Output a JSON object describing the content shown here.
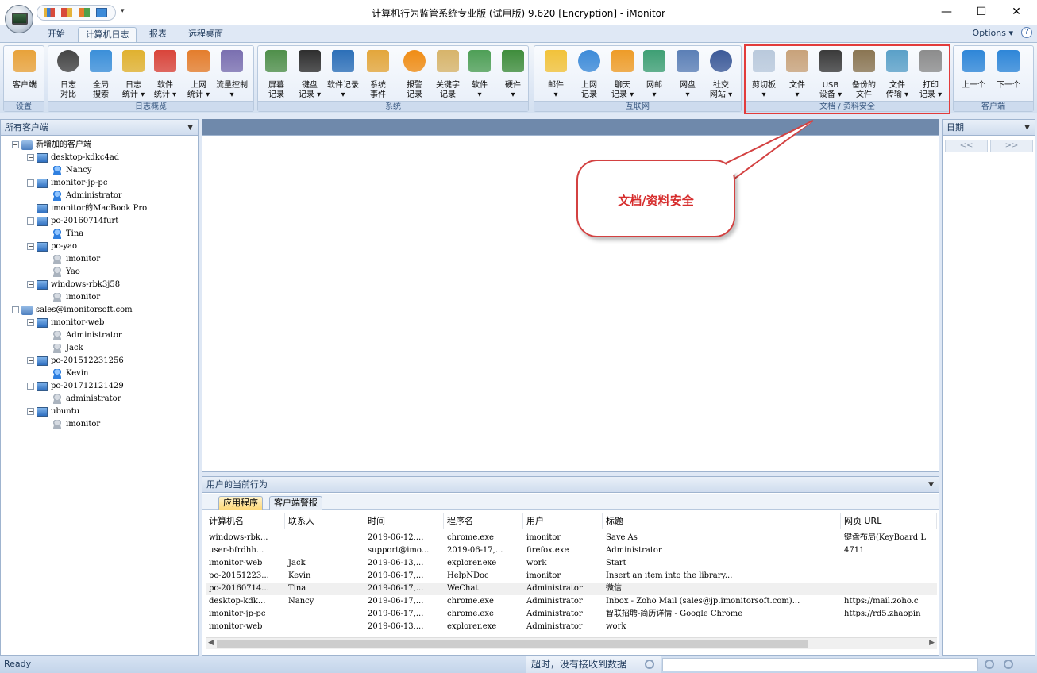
{
  "window": {
    "title": "计算机行为监管系统专业版 (试用版) 9.620 [Encryption] - iMonitor",
    "minimize": "—",
    "maximize": "☐",
    "close": "✕"
  },
  "quick_access": {
    "more": "▾"
  },
  "tabs": [
    {
      "label": "开始"
    },
    {
      "label": "计算机日志"
    },
    {
      "label": "报表"
    },
    {
      "label": "远程桌面"
    }
  ],
  "options": {
    "label": "Options ▾",
    "help": "?"
  },
  "ribbon": {
    "groups": [
      {
        "label": "设置",
        "buttons": [
          {
            "label": "客户端",
            "color": "#e8a23a"
          }
        ]
      },
      {
        "label": "日志概览",
        "buttons": [
          {
            "label": "日志\n对比",
            "color": "#444444"
          },
          {
            "label": "全局\n搜索",
            "color": "#3b8fd9"
          },
          {
            "label": "日志\n统计 ▾",
            "color": "#e0b12f"
          },
          {
            "label": "软件\n统计 ▾",
            "color": "#d9443a"
          },
          {
            "label": "上网\n统计 ▾",
            "color": "#e47d2c"
          },
          {
            "label": "流量控制\n▾",
            "color": "#7a6fb0"
          }
        ]
      },
      {
        "label": "系统",
        "buttons": [
          {
            "label": "屏幕\n记录",
            "color": "#4f8f4a"
          },
          {
            "label": "键盘\n记录 ▾",
            "color": "#2e2e2e"
          },
          {
            "label": "软件记录\n▾",
            "color": "#2c6fb8"
          },
          {
            "label": "系统\n事件",
            "color": "#e3a63b"
          },
          {
            "label": "报警\n记录",
            "color": "#f08c14"
          },
          {
            "label": "关键字\n记录",
            "color": "#d7b46a"
          },
          {
            "label": "软件\n▾",
            "color": "#4e9f56"
          },
          {
            "label": "硬件\n▾",
            "color": "#3f8d3c"
          }
        ]
      },
      {
        "label": "互联网",
        "buttons": [
          {
            "label": "邮件\n▾",
            "color": "#f2c23a"
          },
          {
            "label": "上网\n记录",
            "color": "#3c8ad8"
          },
          {
            "label": "聊天\n记录 ▾",
            "color": "#ee9c28"
          },
          {
            "label": "网邮\n▾",
            "color": "#3e9f74"
          },
          {
            "label": "网盘\n▾",
            "color": "#5b7fb6"
          },
          {
            "label": "社交\n网站 ▾",
            "color": "#3b5998"
          }
        ]
      },
      {
        "label": "文档 / 资料安全",
        "buttons": [
          {
            "label": "剪切板\n▾",
            "color": "#b9c9dc"
          },
          {
            "label": "文件\n▾",
            "color": "#c8a27a"
          },
          {
            "label": "USB\n设备 ▾",
            "color": "#3a3a3a"
          },
          {
            "label": "备份的\n文件",
            "color": "#8a7552"
          },
          {
            "label": "文件\n传输 ▾",
            "color": "#5aa0c8"
          },
          {
            "label": "打印\n记录 ▾",
            "color": "#8c8c8c"
          }
        ]
      },
      {
        "label": "客户端",
        "buttons": [
          {
            "label": "上一个",
            "color": "#2e86d8"
          },
          {
            "label": "下一个",
            "color": "#2e86d8"
          }
        ]
      }
    ]
  },
  "left_panel": {
    "title": "所有客户端",
    "drop": "▼",
    "tree": [
      {
        "label": "新增加的客户端",
        "kind": "group",
        "level": 0,
        "exp": "−"
      },
      {
        "label": "desktop-kdkc4ad",
        "kind": "pc",
        "level": 1,
        "exp": "−"
      },
      {
        "label": "Nancy",
        "kind": "user",
        "level": 2
      },
      {
        "label": "imonitor-jp-pc",
        "kind": "pc",
        "level": 1,
        "exp": "−"
      },
      {
        "label": "Administrator",
        "kind": "user",
        "level": 2
      },
      {
        "label": "imonitor的MacBook Pro",
        "kind": "pc",
        "level": 1
      },
      {
        "label": "pc-20160714furt",
        "kind": "pc",
        "level": 1,
        "exp": "−"
      },
      {
        "label": "Tina",
        "kind": "user",
        "level": 2
      },
      {
        "label": "pc-yao",
        "kind": "pc",
        "level": 1,
        "exp": "−"
      },
      {
        "label": "imonitor",
        "kind": "user-off",
        "level": 2
      },
      {
        "label": "Yao",
        "kind": "user-off",
        "level": 2
      },
      {
        "label": "windows-rbk3j58",
        "kind": "pc",
        "level": 1,
        "exp": "−"
      },
      {
        "label": "imonitor",
        "kind": "user-off",
        "level": 2
      },
      {
        "label": "sales@imonitorsoft.com",
        "kind": "group",
        "level": 0,
        "exp": "−"
      },
      {
        "label": "imonitor-web",
        "kind": "pc",
        "level": 1,
        "exp": "−"
      },
      {
        "label": "Administrator",
        "kind": "user-off",
        "level": 2
      },
      {
        "label": "Jack",
        "kind": "user-off",
        "level": 2
      },
      {
        "label": "pc-201512231256",
        "kind": "pc",
        "level": 1,
        "exp": "−"
      },
      {
        "label": "Kevin",
        "kind": "user",
        "level": 2
      },
      {
        "label": "pc-201712121429",
        "kind": "pc",
        "level": 1,
        "exp": "−"
      },
      {
        "label": "administrator",
        "kind": "user-off",
        "level": 2
      },
      {
        "label": "ubuntu",
        "kind": "pc",
        "level": 1,
        "exp": "−"
      },
      {
        "label": "imonitor",
        "kind": "user-off",
        "level": 2
      }
    ]
  },
  "callout": {
    "text": "文档/资料安全"
  },
  "right_panel": {
    "title": "日期",
    "drop": "▼",
    "prev": "<<",
    "next": ">>"
  },
  "bottom_panel": {
    "title": "用户的当前行为",
    "drop": "▼",
    "tabs": [
      {
        "label": "应用程序"
      },
      {
        "label": "客户端警报"
      }
    ],
    "columns": [
      "计算机名",
      "联系人",
      "时间",
      "程序名",
      "用户",
      "标题",
      "网页 URL"
    ],
    "rows": [
      [
        "windows-rbk...",
        "",
        "2019-06-12,...",
        "chrome.exe",
        "imonitor",
        "Save As",
        "键盘布局(KeyBoard L"
      ],
      [
        "user-bfrdhh...",
        "",
        "support@imo...",
        "2019-06-17,...",
        "firefox.exe",
        "Administrator",
        "4711"
      ],
      [
        "imonitor-web",
        "Jack",
        "2019-06-13,...",
        "explorer.exe",
        "work",
        "Start",
        ""
      ],
      [
        "pc-20151223...",
        "Kevin",
        "2019-06-17,...",
        "HelpNDoc",
        "imonitor",
        "Insert an item into the library...",
        ""
      ],
      [
        "pc-20160714...",
        "Tina",
        "2019-06-17,...",
        "WeChat",
        "Administrator",
        "微信",
        ""
      ],
      [
        "desktop-kdk...",
        "Nancy",
        "2019-06-17,...",
        "chrome.exe",
        "Administrator",
        "Inbox - Zoho Mail (sales@jp.imonitorsoft.com)...",
        "https://mail.zoho.c"
      ],
      [
        "imonitor-jp-pc",
        "",
        "2019-06-17,...",
        "chrome.exe",
        "Administrator",
        "智联招聘-简历详情 - Google Chrome",
        "https://rd5.zhaopin"
      ],
      [
        "imonitor-web",
        "",
        "2019-06-13,...",
        "explorer.exe",
        "Administrator",
        "work",
        ""
      ]
    ],
    "scroll_left": "◀",
    "scroll_right": "▶"
  },
  "status": {
    "ready": "Ready",
    "message": "超时，没有接收到数据"
  }
}
